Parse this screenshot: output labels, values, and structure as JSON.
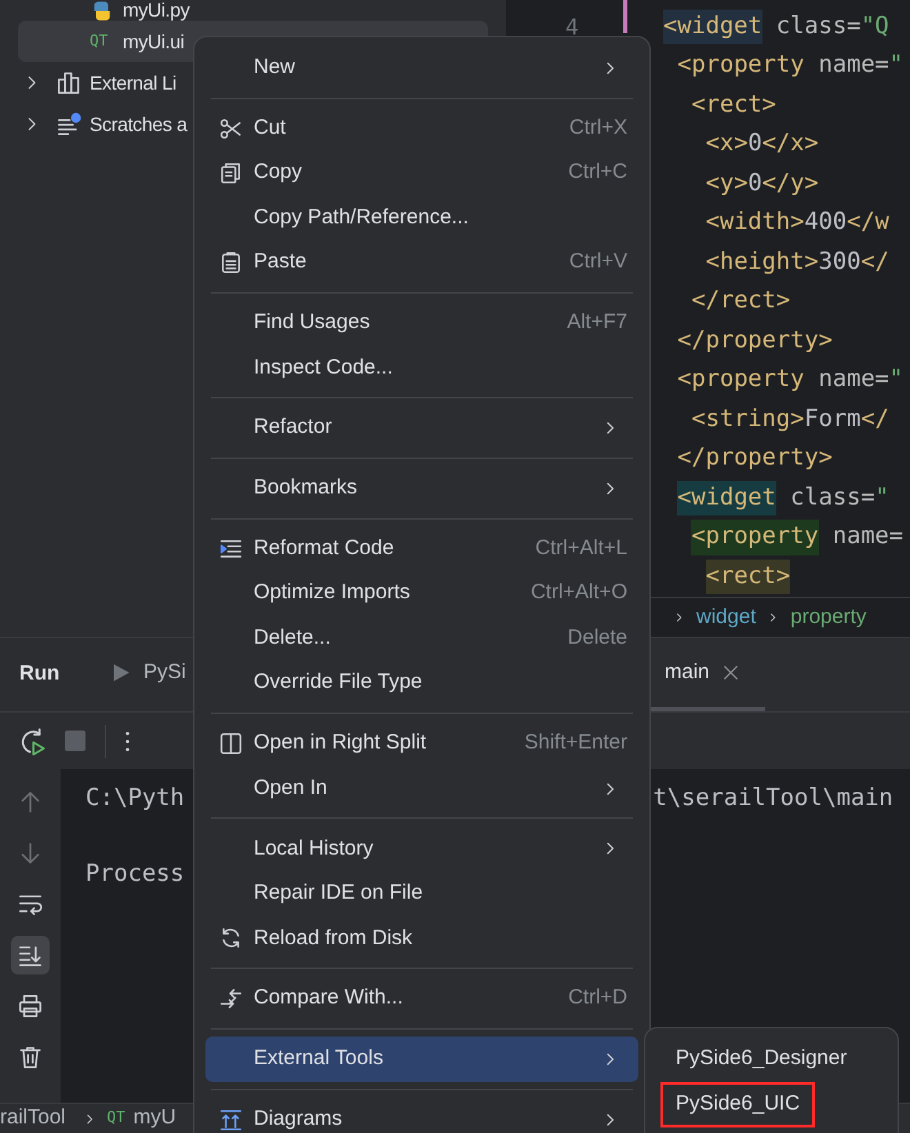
{
  "project_tree": [
    {
      "label": "myUi.py",
      "kind": "python",
      "selected": false
    },
    {
      "label": "myUi.ui",
      "kind": "qt",
      "badge": "QT",
      "selected": true
    },
    {
      "label": "External Li",
      "kind": "library",
      "expanded": false,
      "selected": false
    },
    {
      "label": "Scratches a",
      "kind": "scratches",
      "expanded": false,
      "selected": false
    }
  ],
  "editor": {
    "line_number": "4",
    "lines": [
      {
        "text": "<widget class=\"Q",
        "kind": "caret"
      },
      {
        "text": " <property name=\"",
        "kind": "plain"
      },
      {
        "text": "  <rect>",
        "kind": "plain"
      },
      {
        "text": "   <x>0</x>",
        "kind": "plain"
      },
      {
        "text": "   <y>0</y>",
        "kind": "plain"
      },
      {
        "text": "   <width>400</w",
        "kind": "plain"
      },
      {
        "text": "   <height>300</",
        "kind": "plain"
      },
      {
        "text": "  </rect>",
        "kind": "plain"
      },
      {
        "text": " </property>",
        "kind": "plain"
      },
      {
        "text": " <property name=\"",
        "kind": "plain"
      },
      {
        "text": "  <string>Form</",
        "kind": "plain"
      },
      {
        "text": " </property>",
        "kind": "plain"
      },
      {
        "text": " <widget class=\"",
        "kind": "scope-1"
      },
      {
        "text": "  <property name=",
        "kind": "scope-2"
      },
      {
        "text": "   <rect>",
        "kind": "scope-3"
      }
    ],
    "breadcrumbs": [
      {
        "label": "widget",
        "kind": "tag"
      },
      {
        "label": "property",
        "kind": "attribute"
      }
    ]
  },
  "run_panel": {
    "title": "Run",
    "tabs": [
      {
        "label": "PySi",
        "selected": false
      },
      {
        "label": "main",
        "selected": true
      }
    ],
    "side_tools": [
      {
        "kind": "up",
        "disabled": true,
        "selected": false
      },
      {
        "kind": "down",
        "disabled": true,
        "selected": false
      },
      {
        "kind": "wrap",
        "disabled": false,
        "selected": false
      },
      {
        "kind": "scroll-end",
        "disabled": false,
        "selected": true
      },
      {
        "kind": "print",
        "disabled": false,
        "selected": false
      },
      {
        "kind": "trash",
        "disabled": false,
        "selected": false
      }
    ],
    "console": [
      {
        "segments": [
          "C:\\Pyth",
          "t\\serailTool\\main"
        ]
      },
      {
        "segments": [
          "Process"
        ]
      }
    ]
  },
  "status_bar": [
    {
      "label": "railTool"
    },
    {
      "label": "myU",
      "badge": "QT"
    }
  ],
  "context_menu": [
    {
      "kind": "item",
      "label": "New",
      "submenu": true,
      "selected": false
    },
    {
      "kind": "separator"
    },
    {
      "kind": "cut",
      "label": "Cut",
      "shortcut": "Ctrl+X",
      "submenu": false,
      "selected": false
    },
    {
      "kind": "copy",
      "label": "Copy",
      "shortcut": "Ctrl+C",
      "submenu": false,
      "selected": false
    },
    {
      "kind": "item",
      "label": "Copy Path/Reference...",
      "submenu": false,
      "selected": false
    },
    {
      "kind": "paste",
      "label": "Paste",
      "shortcut": "Ctrl+V",
      "submenu": false,
      "selected": false
    },
    {
      "kind": "separator"
    },
    {
      "kind": "item",
      "label": "Find Usages",
      "shortcut": "Alt+F7",
      "submenu": false,
      "selected": false
    },
    {
      "kind": "item",
      "label": "Inspect Code...",
      "submenu": false,
      "selected": false
    },
    {
      "kind": "separator"
    },
    {
      "kind": "item",
      "label": "Refactor",
      "submenu": true,
      "selected": false
    },
    {
      "kind": "separator"
    },
    {
      "kind": "item",
      "label": "Bookmarks",
      "submenu": true,
      "selected": false
    },
    {
      "kind": "separator"
    },
    {
      "kind": "reformat",
      "label": "Reformat Code",
      "shortcut": "Ctrl+Alt+L",
      "submenu": false,
      "selected": false
    },
    {
      "kind": "item",
      "label": "Optimize Imports",
      "shortcut": "Ctrl+Alt+O",
      "submenu": false,
      "selected": false
    },
    {
      "kind": "item",
      "label": "Delete...",
      "shortcut": "Delete",
      "submenu": false,
      "selected": false
    },
    {
      "kind": "item",
      "label": "Override File Type",
      "submenu": false,
      "selected": false
    },
    {
      "kind": "separator"
    },
    {
      "kind": "split",
      "label": "Open in Right Split",
      "shortcut": "Shift+Enter",
      "submenu": false,
      "selected": false
    },
    {
      "kind": "item",
      "label": "Open In",
      "submenu": true,
      "selected": false
    },
    {
      "kind": "separator"
    },
    {
      "kind": "item",
      "label": "Local History",
      "submenu": true,
      "selected": false
    },
    {
      "kind": "item",
      "label": "Repair IDE on File",
      "submenu": false,
      "selected": false
    },
    {
      "kind": "reload",
      "label": "Reload from Disk",
      "submenu": false,
      "selected": false
    },
    {
      "kind": "separator"
    },
    {
      "kind": "compare",
      "label": "Compare With...",
      "shortcut": "Ctrl+D",
      "submenu": false,
      "selected": false
    },
    {
      "kind": "separator"
    },
    {
      "kind": "item",
      "label": "External Tools",
      "submenu": true,
      "selected": true
    },
    {
      "kind": "separator"
    },
    {
      "kind": "diagrams",
      "label": "Diagrams",
      "submenu": true,
      "selected": false
    }
  ],
  "submenu": [
    {
      "label": "PySide6_Designer",
      "annotated": false
    },
    {
      "label": "PySide6_UIC",
      "annotated": true
    }
  ]
}
